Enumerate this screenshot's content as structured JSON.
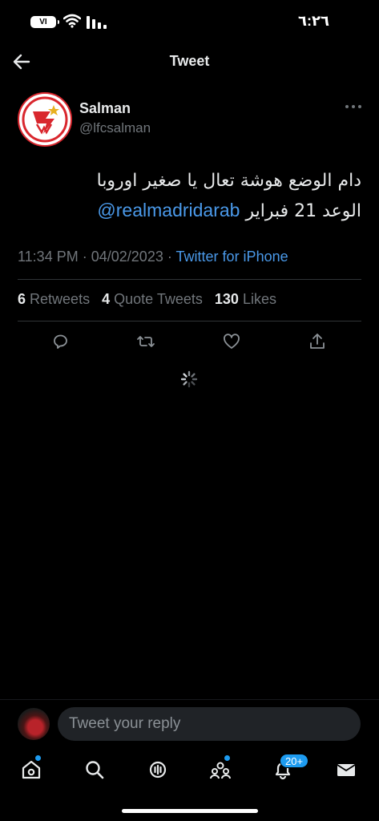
{
  "status_bar": {
    "battery": "VI",
    "time": "٦:٢٦"
  },
  "header": {
    "title": "Tweet",
    "back_icon": "arrow-left-icon"
  },
  "tweet": {
    "display_name": "Salman",
    "handle": "@lfcsalman",
    "text_line1": "دام الوضع هوشة تعال يا صغير اوروبا",
    "text_line2_prefix": "الوعد 21 فبراير",
    "mention": "@realmadridarab",
    "time": "11:34 PM",
    "separator": "·",
    "date": "04/02/2023",
    "source": "Twitter for iPhone"
  },
  "stats": {
    "retweets_count": "6",
    "retweets_label": "Retweets",
    "quotes_count": "4",
    "quotes_label": "Quote Tweets",
    "likes_count": "130",
    "likes_label": "Likes"
  },
  "reply": {
    "placeholder": "Tweet your reply"
  },
  "nav": {
    "notifications_badge": "20+"
  },
  "colors": {
    "background": "#000000",
    "link": "#4a99e9",
    "muted": "#71767b",
    "accent": "#1d9bf0",
    "avatar_red": "#d9272e"
  }
}
